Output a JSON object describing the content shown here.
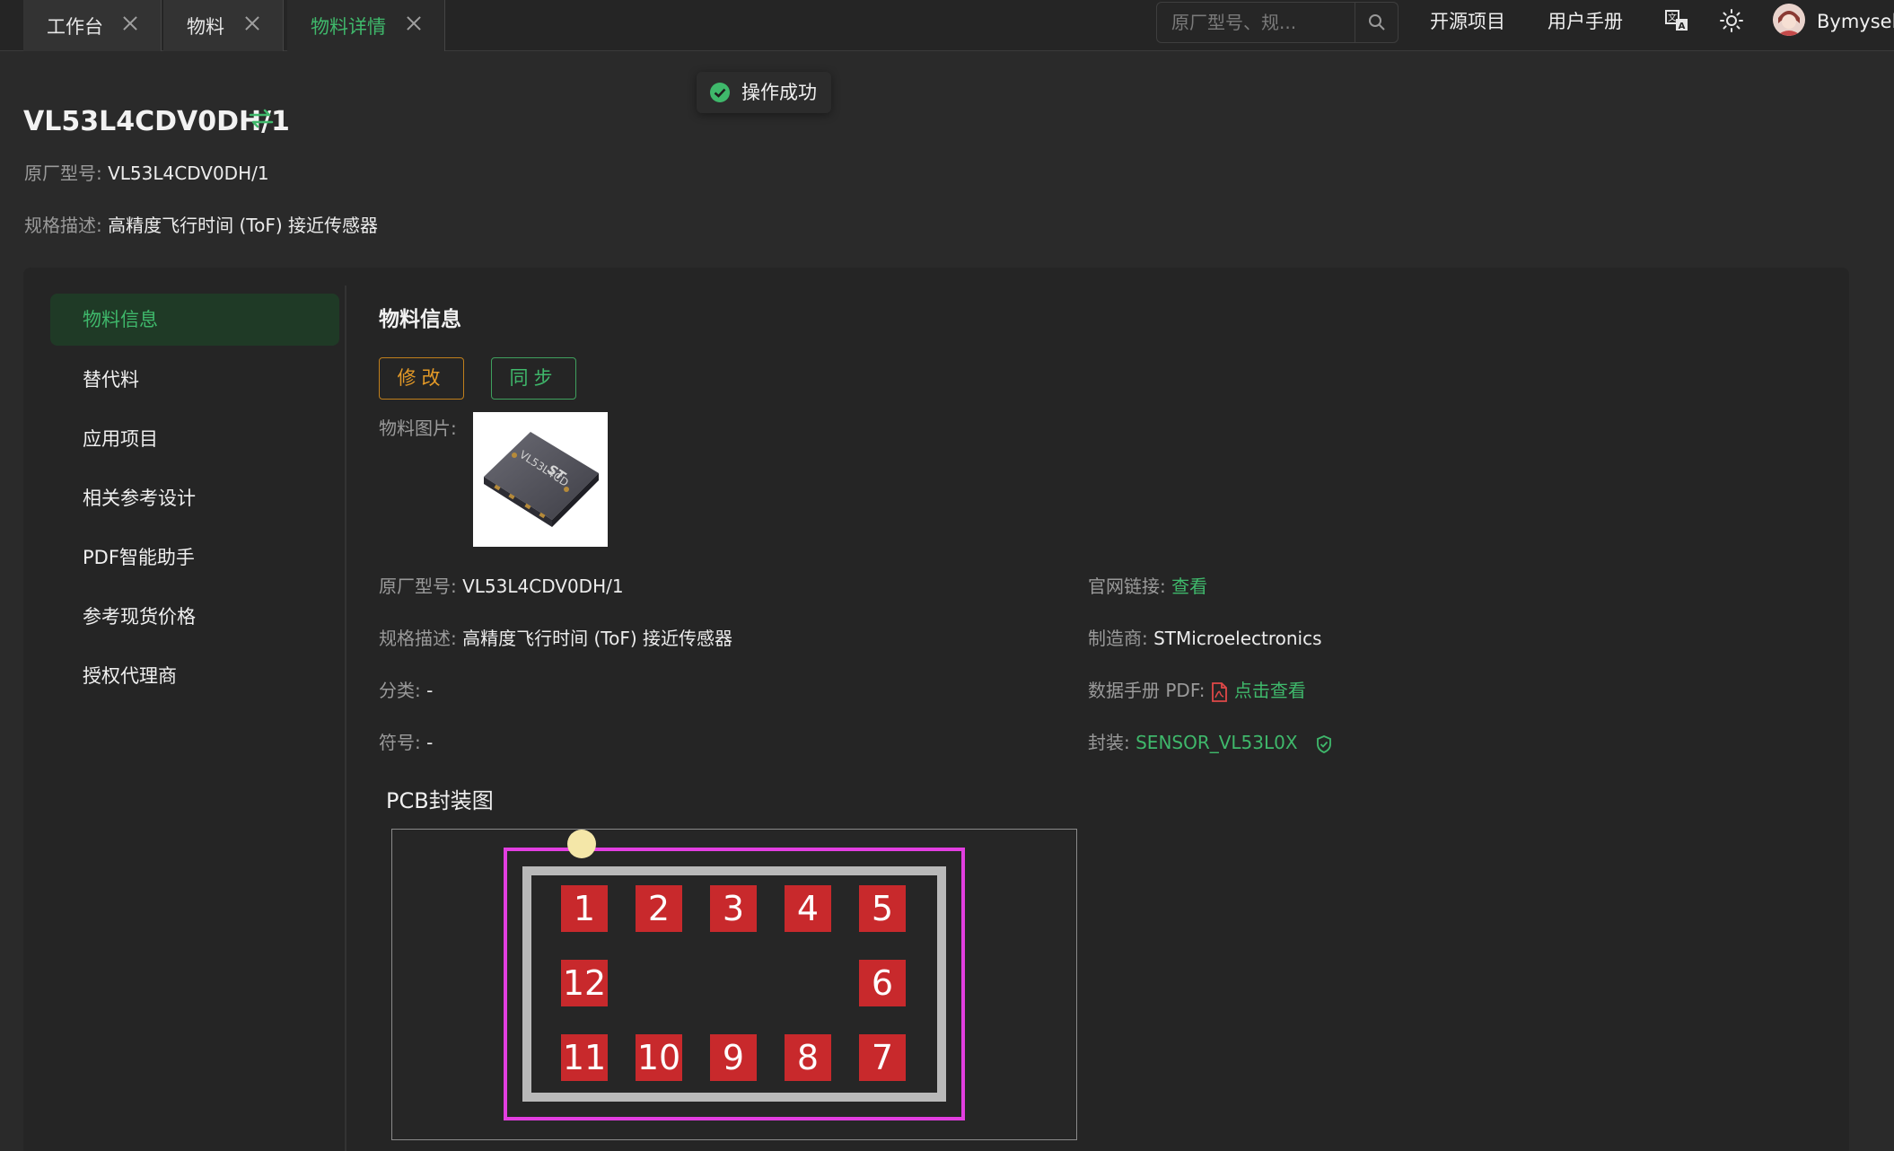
{
  "tabs": [
    {
      "label": "工作台",
      "active": false
    },
    {
      "label": "物料",
      "active": false
    },
    {
      "label": "物料详情",
      "active": true
    }
  ],
  "topbar": {
    "search_placeholder": "原厂型号、规...",
    "link_open_source": "开源项目",
    "link_manual": "用户手册",
    "icons": [
      "translate-icon",
      "theme-sun-icon"
    ],
    "username": "Bymyself"
  },
  "toast": {
    "text": "操作成功",
    "status_color": "#3fb86b"
  },
  "header": {
    "title": "VL53L4CDV0DH/1",
    "mfr_part_label": "原厂型号:",
    "mfr_part_value": "VL53L4CDV0DH/1",
    "spec_label": "规格描述:",
    "spec_value": "高精度飞行时间 (ToF) 接近传感器"
  },
  "sidebar": {
    "items": [
      {
        "label": "物料信息",
        "active": true
      },
      {
        "label": "替代料",
        "active": false
      },
      {
        "label": "应用项目",
        "active": false
      },
      {
        "label": "相关参考设计",
        "active": false
      },
      {
        "label": "PDF智能助手",
        "active": false
      },
      {
        "label": "参考现货价格",
        "active": false
      },
      {
        "label": "授权代理商",
        "active": false
      }
    ]
  },
  "main": {
    "section_title": "物料信息",
    "edit_button": "修改",
    "sync_button": "同步",
    "image_label": "物料图片:",
    "chip_marking": "VL53L4CD",
    "fields": {
      "mfr_part_label": "原厂型号:",
      "mfr_part_value": "VL53L4CDV0DH/1",
      "spec_label": "规格描述:",
      "spec_value": "高精度飞行时间 (ToF) 接近传感器",
      "category_label": "分类:",
      "category_value": "-",
      "symbol_label": "符号:",
      "symbol_value": "-",
      "website_label": "官网链接:",
      "website_value": "查看",
      "manufacturer_label": "制造商:",
      "manufacturer_value": "STMicroelectronics",
      "datasheet_label": "数据手册 PDF:",
      "datasheet_value": "点击查看",
      "package_label": "封装:",
      "package_value": "SENSOR_VL53L0X"
    },
    "pcb_title": "PCB封装图",
    "pads": [
      "1",
      "2",
      "3",
      "4",
      "5",
      "6",
      "7",
      "8",
      "9",
      "10",
      "11",
      "12"
    ]
  },
  "colors": {
    "accent_green": "#3fb86b",
    "edit_orange": "#e49a27",
    "pad_red": "#c8292c",
    "silkscreen_magenta": "#e23ee0",
    "pdf_red": "#e04848"
  }
}
